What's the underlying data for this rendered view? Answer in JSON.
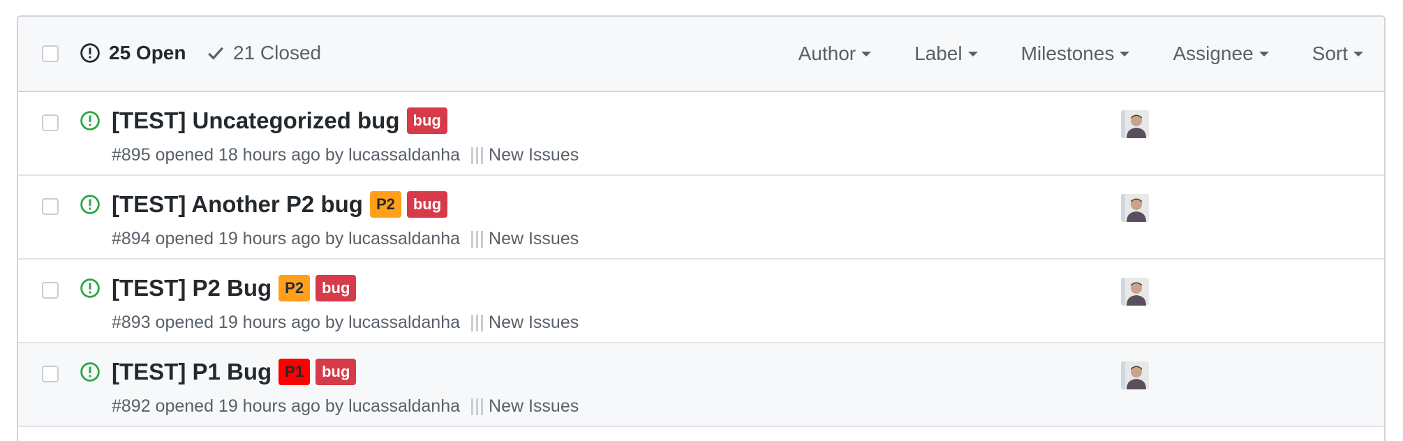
{
  "header": {
    "open_label": "25 Open",
    "closed_label": "21 Closed",
    "filters": [
      {
        "label": "Author"
      },
      {
        "label": "Label"
      },
      {
        "label": "Milestones"
      },
      {
        "label": "Assignee"
      },
      {
        "label": "Sort"
      }
    ]
  },
  "issues": [
    {
      "title": "[TEST] Uncategorized bug",
      "labels": [
        {
          "text": "bug",
          "color": "#d73a49"
        }
      ],
      "meta": "#895 opened 18 hours ago by lucassaldanha",
      "milestone": "New Issues"
    },
    {
      "title": "[TEST] Another P2 bug",
      "labels": [
        {
          "text": "P2",
          "color": "#ff9f1a"
        },
        {
          "text": "bug",
          "color": "#d73a49"
        }
      ],
      "meta": "#894 opened 19 hours ago by lucassaldanha",
      "milestone": "New Issues"
    },
    {
      "title": "[TEST] P2 Bug",
      "labels": [
        {
          "text": "P2",
          "color": "#ff9f1a"
        },
        {
          "text": "bug",
          "color": "#d73a49"
        }
      ],
      "meta": "#893 opened 19 hours ago by lucassaldanha",
      "milestone": "New Issues"
    },
    {
      "title": "[TEST] P1 Bug",
      "labels": [
        {
          "text": "P1",
          "color": "#ff0000"
        },
        {
          "text": "bug",
          "color": "#d73a49"
        }
      ],
      "meta": "#892 opened 19 hours ago by lucassaldanha",
      "milestone": "New Issues"
    }
  ],
  "colors": {
    "open_icon": "#28a745",
    "header_bg": "#f6f8fa",
    "border": "#d1d5da"
  }
}
